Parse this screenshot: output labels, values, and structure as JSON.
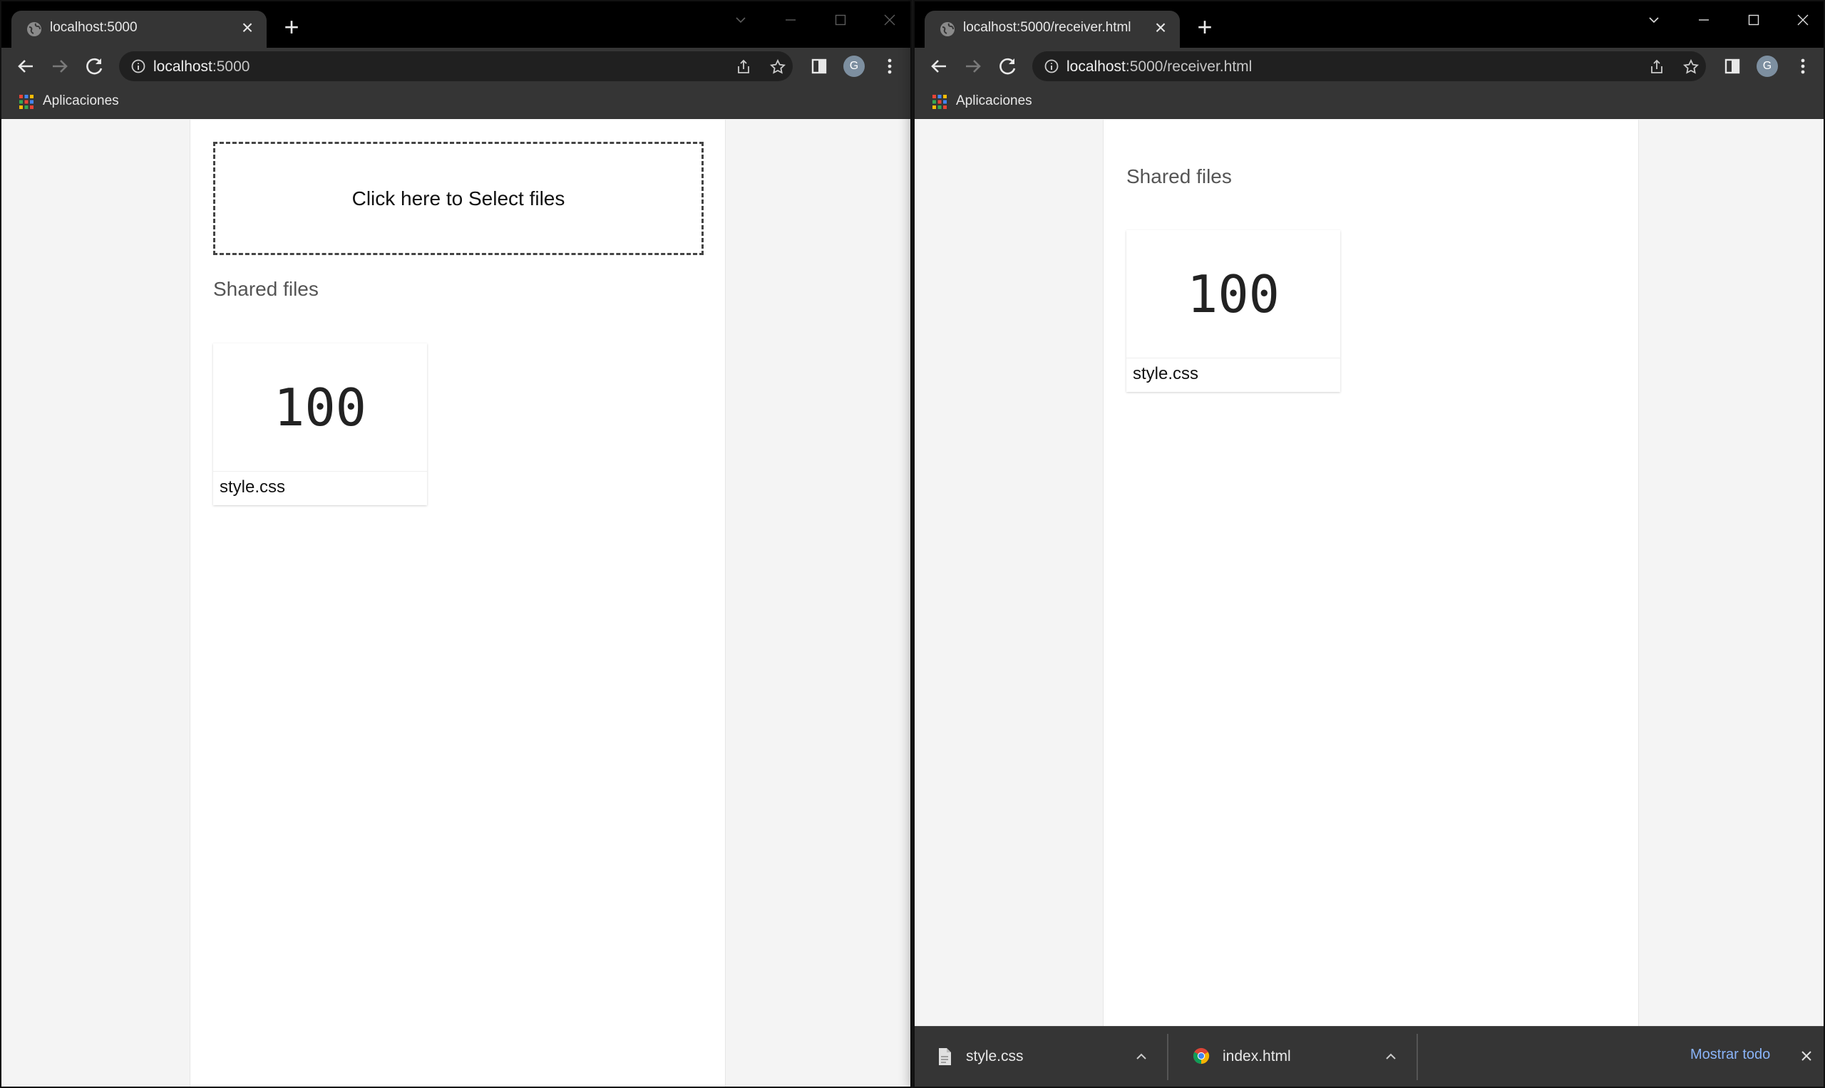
{
  "left_window": {
    "tab_title": "localhost:5000",
    "url_host": "localhost",
    "url_rest": ":5000",
    "avatar_letter": "G",
    "bookmark_label": "Aplicaciones",
    "dropzone_label": "Click here to Select files",
    "section_title": "Shared files",
    "file": {
      "preview": "100",
      "name": "style.css"
    }
  },
  "right_window": {
    "tab_title": "localhost:5000/receiver.html",
    "url_host": "localhost",
    "url_rest": ":5000/receiver.html",
    "avatar_letter": "G",
    "bookmark_label": "Aplicaciones",
    "section_title": "Shared files",
    "file": {
      "preview": "100",
      "name": "style.css"
    },
    "download_shelf": {
      "items": [
        {
          "name": "style.css",
          "icon": "file-icon"
        },
        {
          "name": "index.html",
          "icon": "chrome-icon"
        }
      ],
      "show_all_label": "Mostrar todo"
    }
  },
  "colors": {
    "titlebar": "#000000",
    "toolbar": "#353535",
    "omnibox": "#202020",
    "page_background": "#f4f4f4",
    "content_column": "#ffffff",
    "link_accent": "#8ab4f8"
  }
}
